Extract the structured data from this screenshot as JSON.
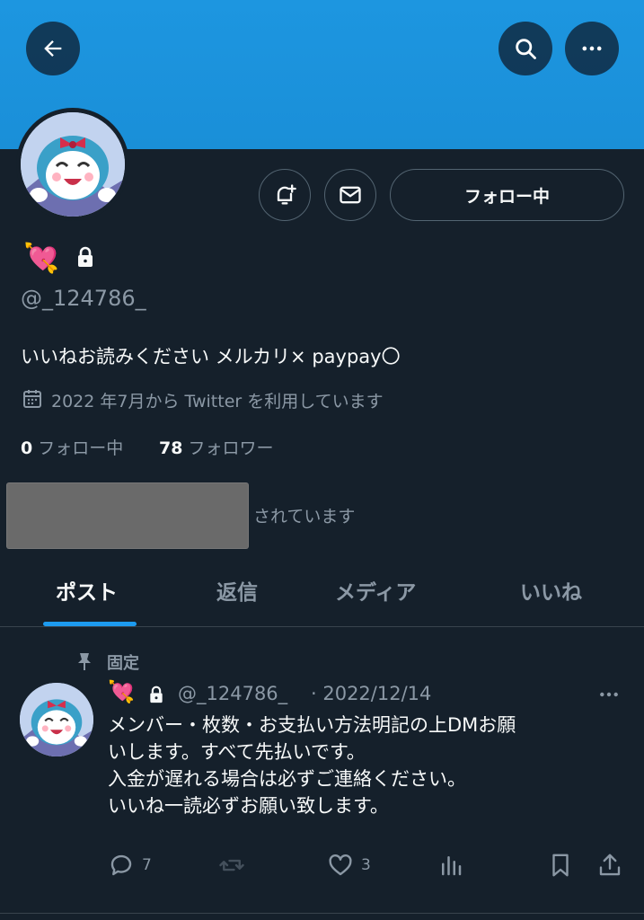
{
  "header": {
    "back_icon": "arrow-left-icon",
    "search_icon": "search-icon",
    "more_icon": "more-horizontal-icon"
  },
  "profile": {
    "name_emoji": "💘",
    "handle": "@_124786_",
    "bio": "いいねお読みください メルカリ× paypay〇",
    "joined": "2022 年7月から Twitter を利用しています",
    "following_count": "0",
    "following_label": "フォロー中",
    "followers_count": "78",
    "followers_label": "フォロワー",
    "followed_by_suffix": "されています",
    "follow_button": "フォロー中"
  },
  "tabs": [
    {
      "label": "ポスト",
      "active": true
    },
    {
      "label": "返信",
      "active": false
    },
    {
      "label": "メディア",
      "active": false
    },
    {
      "label": "いいね",
      "active": false
    }
  ],
  "tweet": {
    "pinned_label": "固定",
    "emoji": "💘",
    "handle": "@_124786_",
    "date": "· 2022/12/14",
    "text": "メンバー・枚数・お支払い方法明記の上DMお願\nいします。すべて先払いです。\n入金が遅れる場合は必ずご連絡ください。\nいいね一読必ずお願い致します。",
    "reply_count": "7",
    "like_count": "3"
  },
  "colors": {
    "accent": "#1d9bf0",
    "background": "#15202b",
    "banner": "#1d96e0"
  }
}
